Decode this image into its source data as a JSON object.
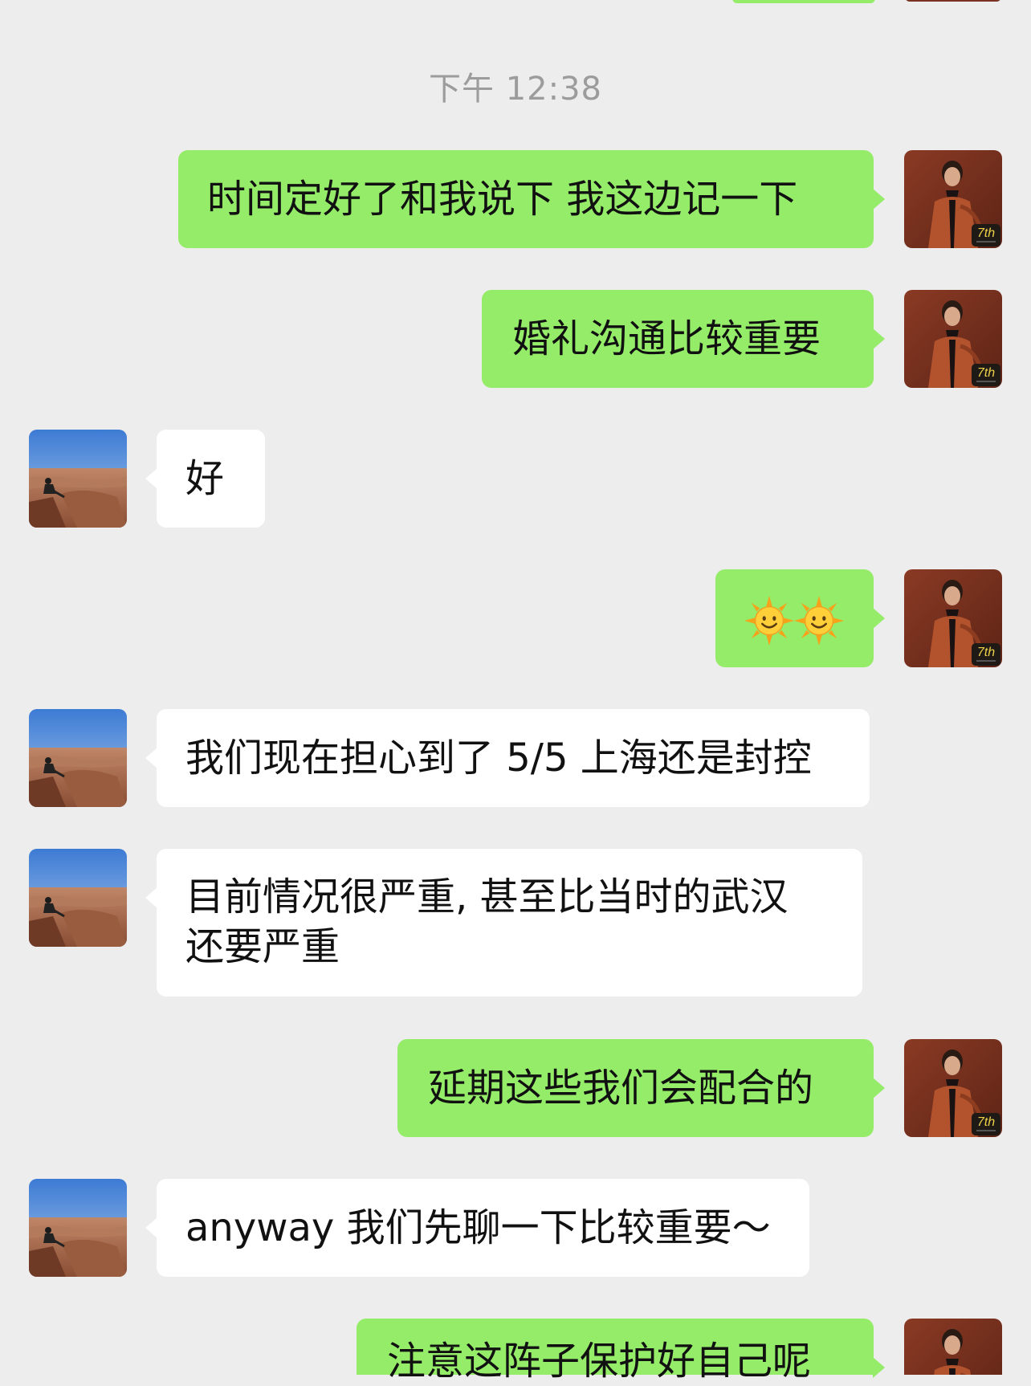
{
  "timestamp": "下午 12:38",
  "messages": [
    {
      "sender": "me",
      "text": "时间定好了和我说下 我这边记一下"
    },
    {
      "sender": "me",
      "text": "婚礼沟通比较重要"
    },
    {
      "sender": "them",
      "text": "好"
    },
    {
      "sender": "me",
      "emoji": [
        "sun-with-face-icon",
        "sun-with-face-icon"
      ]
    },
    {
      "sender": "them",
      "text": "我们现在担心到了 5/5 上海还是封控"
    },
    {
      "sender": "them",
      "lines": [
        "目前情况很严重, 甚至比当时的武汉",
        "还要严重"
      ]
    },
    {
      "sender": "me",
      "text": "延期这些我们会配合的"
    },
    {
      "sender": "them",
      "text": "anyway 我们先聊一下比较重要～"
    },
    {
      "sender": "me",
      "text": "注意这阵子保护好自己呢"
    }
  ],
  "my_avatar_badge": "7th",
  "colors": {
    "background": "#ededed",
    "my_bubble": "#95ec69",
    "their_bubble": "#ffffff",
    "timestamp": "#9c9c9c"
  }
}
